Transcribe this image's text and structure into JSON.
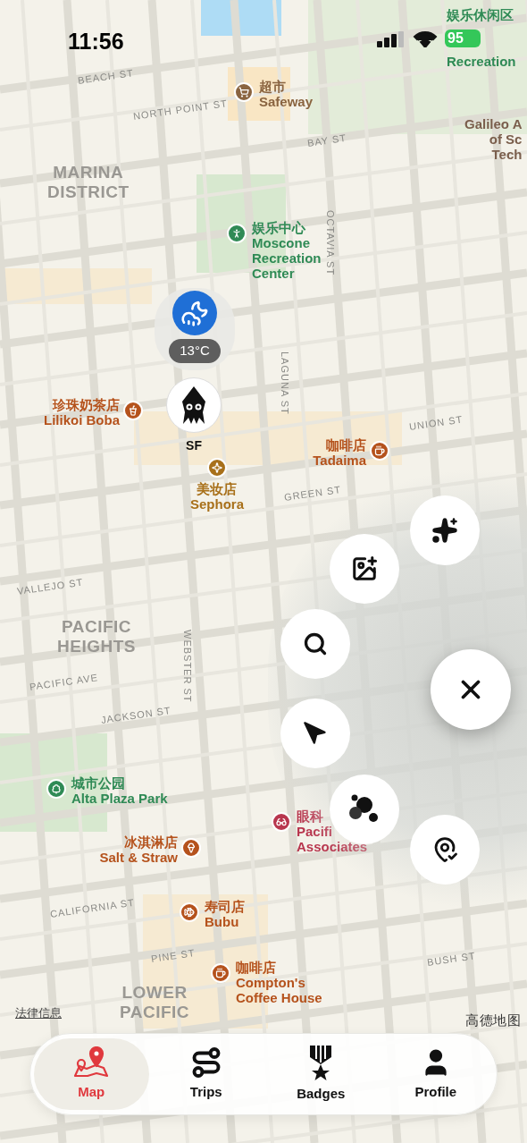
{
  "status_bar": {
    "time": "11:56",
    "battery": "95"
  },
  "map": {
    "streets": [
      "BEACH ST",
      "NORTH POINT ST",
      "BAY ST",
      "OCTAVIA ST",
      "LAGUNA ST",
      "UNION ST",
      "GREEN ST",
      "VALLEJO ST",
      "WEBSTER ST",
      "PACIFIC AVE",
      "JACKSON ST",
      "CALIFORNIA ST",
      "PINE ST",
      "BUSH ST"
    ],
    "districts": [
      [
        "MARINA",
        "DISTRICT"
      ],
      [
        "PACIFIC",
        "HEIGHTS"
      ],
      [
        "LOWER",
        "PACIFIC"
      ]
    ],
    "pois": [
      {
        "kind": "supermarket",
        "lines": [
          "超市",
          "Safeway"
        ],
        "color": "#8a6440"
      },
      {
        "kind": "recreation",
        "lines": [
          "娱乐中心",
          "Moscone",
          "Recreation",
          "Center"
        ],
        "color": "#2f8a55"
      },
      {
        "kind": "tea",
        "lines": [
          "珍珠奶茶店",
          "Lilikoi Boba"
        ],
        "color": "#b5521c"
      },
      {
        "kind": "cafe",
        "lines": [
          "咖啡店",
          "Tadaima"
        ],
        "color": "#b5521c"
      },
      {
        "kind": "beauty",
        "lines": [
          "美妆店",
          "Sephora"
        ],
        "color": "#a8701a"
      },
      {
        "kind": "park",
        "lines": [
          "城市公园",
          "Alta Plaza Park"
        ],
        "color": "#2f8a55"
      },
      {
        "kind": "optician",
        "lines": [
          "眼科",
          "Pacifi",
          "Associates"
        ],
        "color": "#b8364e"
      },
      {
        "kind": "icecream",
        "lines": [
          "冰淇淋店",
          "Salt & Straw"
        ],
        "color": "#b5521c"
      },
      {
        "kind": "sushi",
        "lines": [
          "寿司店",
          "Bubu"
        ],
        "color": "#b5521c"
      },
      {
        "kind": "cafe",
        "lines": [
          "咖啡店",
          "Compton's",
          "Coffee House"
        ],
        "color": "#b5521c"
      }
    ],
    "edge_labels": [
      {
        "lines": [
          "娱乐休闲区",
          "Recreation"
        ],
        "color": "#2f8a55"
      },
      {
        "lines": [
          "Galileo A",
          "of Sc",
          "Tech"
        ],
        "color": "#7a5e4c"
      }
    ]
  },
  "weather_pin": {
    "temperature": "13°C"
  },
  "user_pin": {
    "label": "SF"
  },
  "attribution": {
    "legal_link": "法律信息",
    "provider": "高德地图"
  },
  "tab_bar": {
    "tabs": [
      {
        "label": "Map",
        "selected": true
      },
      {
        "label": "Trips",
        "selected": false
      },
      {
        "label": "Badges",
        "selected": false
      },
      {
        "label": "Profile",
        "selected": false
      }
    ]
  }
}
